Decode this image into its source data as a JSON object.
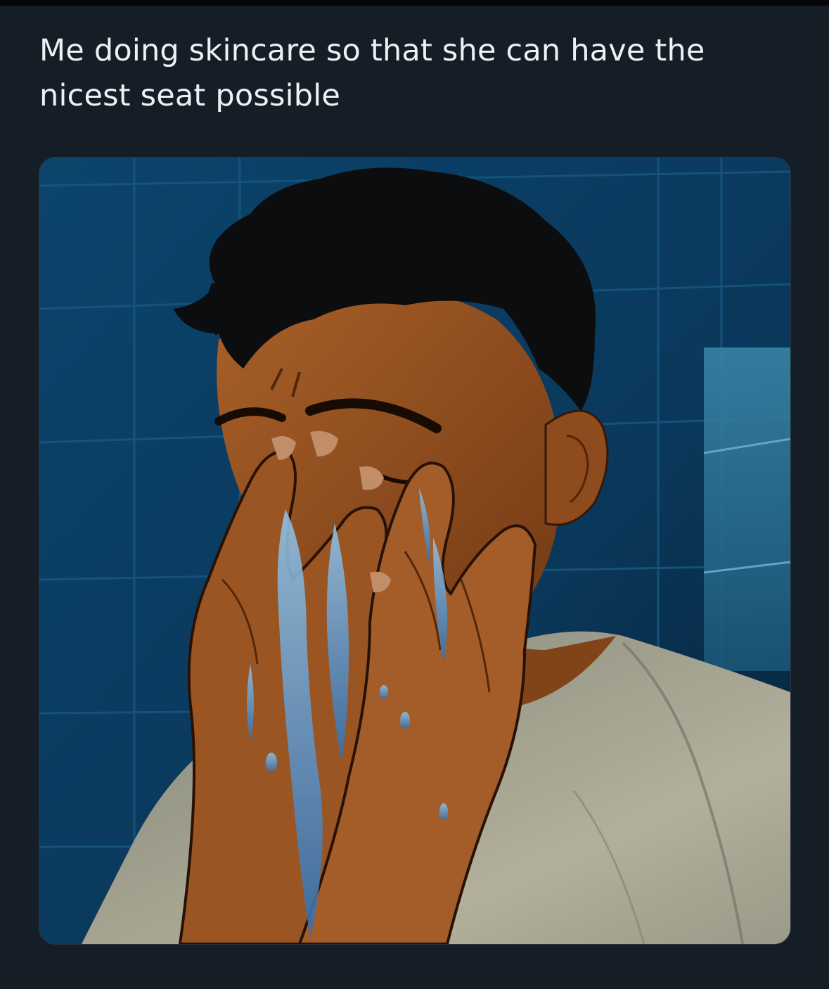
{
  "post": {
    "text": "Me doing skincare so that she can have the nicest seat possible"
  },
  "media": {
    "kind": "illustration",
    "subject": "man washing face with water in a blue-tiled bathroom"
  },
  "colors": {
    "background": "#151d27",
    "text": "#eef1f4",
    "tile_blue": "#0d4770",
    "skin": "#a65a25",
    "hair": "#0d0f10",
    "shirt": "#b9b8a3",
    "water": "#7fb6e6"
  }
}
